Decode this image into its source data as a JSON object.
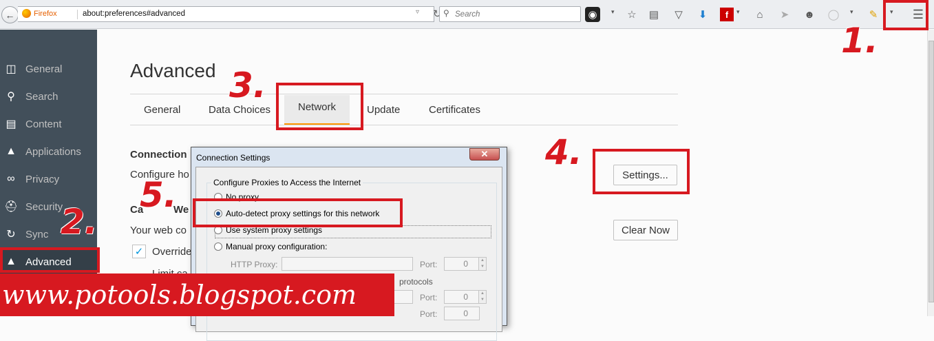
{
  "browser": {
    "identity_label": "Firefox",
    "url": "about:preferences#advanced",
    "search_placeholder": "Search"
  },
  "sidebar": {
    "items": [
      {
        "label": "General",
        "icon": "general-icon"
      },
      {
        "label": "Search",
        "icon": "search-icon"
      },
      {
        "label": "Content",
        "icon": "content-icon"
      },
      {
        "label": "Applications",
        "icon": "rocket-icon"
      },
      {
        "label": "Privacy",
        "icon": "mask-icon"
      },
      {
        "label": "Security",
        "icon": "helmet-icon"
      },
      {
        "label": "Sync",
        "icon": "sync-icon"
      },
      {
        "label": "Advanced",
        "icon": "wizard-hat-icon"
      }
    ],
    "selected": "Advanced"
  },
  "main": {
    "title": "Advanced",
    "tabs": [
      "General",
      "Data Choices",
      "Network",
      "Update",
      "Certificates"
    ],
    "selected_tab": "Network",
    "connection_heading": "Connection",
    "connection_desc": "Configure ho",
    "settings_button": "Settings...",
    "cache_heading": "Ca",
    "cache_heading_tail": "We",
    "cache_desc": "Your web co",
    "clear_now_button": "Clear Now",
    "override_label": "Override",
    "limit_label": "Limit ca"
  },
  "dialog": {
    "title": "Connection Settings",
    "group_label": "Configure Proxies to Access the Internet",
    "options": [
      "No proxy",
      "Auto-detect proxy settings for this network",
      "Use system proxy settings",
      "Manual proxy configuration:"
    ],
    "selected_option": "Auto-detect proxy settings for this network",
    "http_proxy_label": "HTTP Proxy:",
    "port_label": "Port:",
    "port_value": "0",
    "partial_text": "protocols"
  },
  "annotations": [
    "1.",
    "2.",
    "3.",
    "4.",
    "5."
  ],
  "watermark": "www.potools.blogspot.com",
  "colors": {
    "annotation": "#d71920",
    "tab_underline": "#ff9500",
    "sidebar_bg": "#424f5a",
    "sidebar_active": "#343f48"
  }
}
